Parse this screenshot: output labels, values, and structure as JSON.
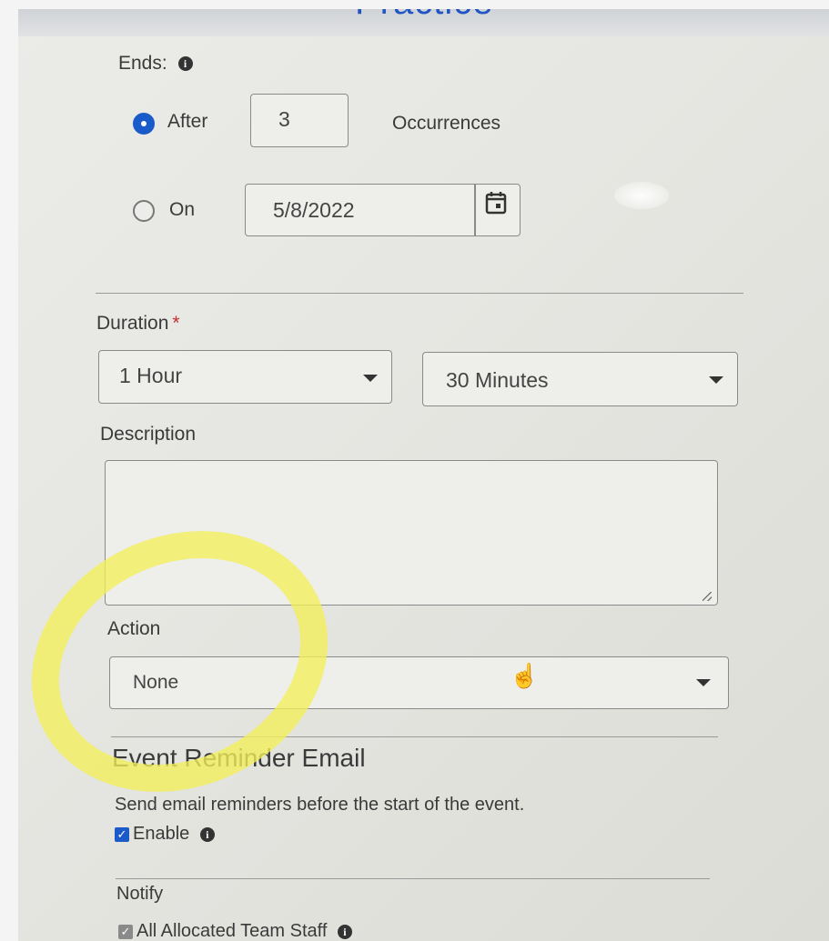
{
  "page": {
    "title": "Practice"
  },
  "ends": {
    "label": "Ends:",
    "after_label": "After",
    "occurrences_value": "3",
    "occurrences_label": "Occurrences",
    "on_label": "On",
    "on_date": "5/8/2022",
    "selected": "after"
  },
  "duration": {
    "label": "Duration",
    "required_mark": "*",
    "hours_value": "1 Hour",
    "minutes_value": "30 Minutes"
  },
  "description": {
    "label": "Description",
    "value": ""
  },
  "action": {
    "label": "Action",
    "value": "None"
  },
  "reminder": {
    "title": "Event Reminder Email",
    "subtitle": "Send email reminders before the start of the event.",
    "enable_label": "Enable",
    "enabled": true
  },
  "notify": {
    "label": "Notify",
    "staff_label": "All Allocated Team Staff",
    "staff_checked": true
  },
  "colors": {
    "accent": "#1b5bc9",
    "highlight": "#f4f05a",
    "required": "#c53030"
  },
  "icons": [
    "info-icon",
    "calendar-icon",
    "chevron-down-icon",
    "hand-cursor-icon"
  ]
}
